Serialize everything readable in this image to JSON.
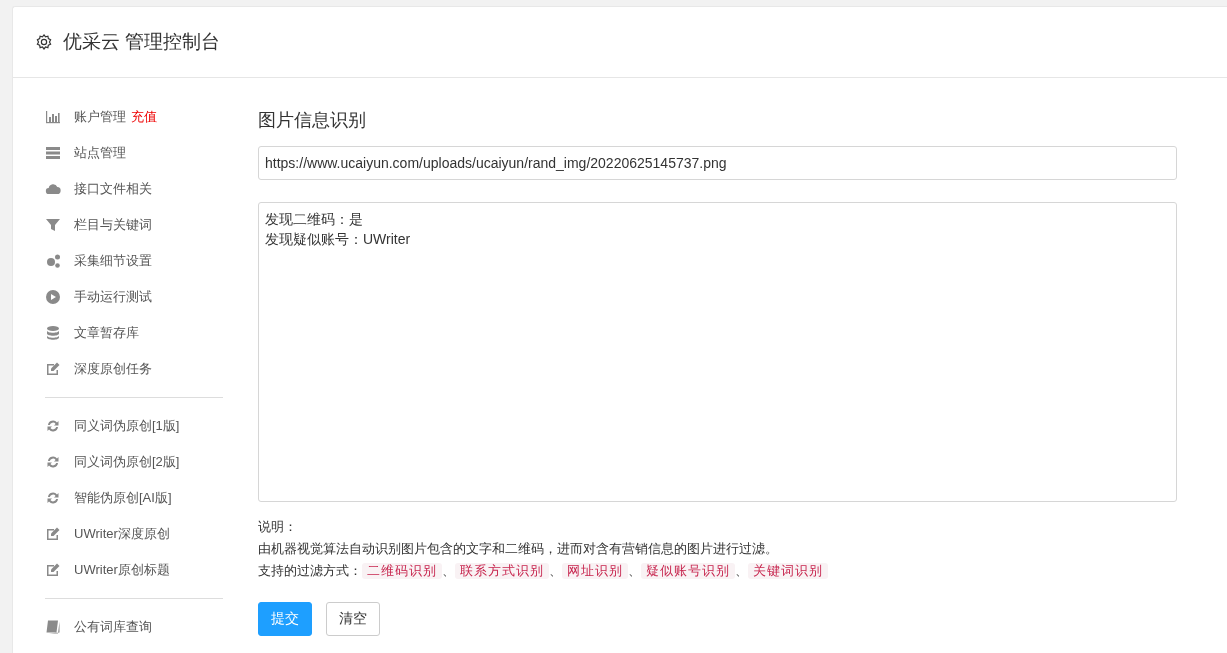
{
  "header": {
    "title": "优采云 管理控制台"
  },
  "sidebar": {
    "sections": [
      {
        "items": [
          {
            "label": "账户管理",
            "badge": "充值"
          },
          {
            "label": "站点管理"
          },
          {
            "label": "接口文件相关"
          },
          {
            "label": "栏目与关键词"
          },
          {
            "label": "采集细节设置"
          },
          {
            "label": "手动运行测试"
          },
          {
            "label": "文章暂存库"
          },
          {
            "label": "深度原创任务"
          }
        ]
      },
      {
        "items": [
          {
            "label": "同义词伪原创[1版]"
          },
          {
            "label": "同义词伪原创[2版]"
          },
          {
            "label": "智能伪原创[AI版]"
          },
          {
            "label": "UWriter深度原创"
          },
          {
            "label": "UWriter原创标题"
          }
        ]
      },
      {
        "items": [
          {
            "label": "公有词库查询"
          }
        ]
      }
    ]
  },
  "main": {
    "title": "图片信息识别",
    "url_field": {
      "value": "https://www.ucaiyun.com/uploads/ucaiyun/rand_img/20220625145737.png"
    },
    "result_field": {
      "lines": [
        "发现二维码：是",
        "发现疑似账号：UWriter"
      ]
    },
    "notes": {
      "heading": "说明：",
      "description": "由机器视觉算法自动识别图片包含的文字和二维码，进而对含有营销信息的图片进行过滤。",
      "filters_label": "支持的过滤方式：",
      "separator": "、",
      "filters": [
        "二维码识别",
        "联系方式识别",
        "网址识别",
        "疑似账号识别",
        "关键词识别"
      ]
    },
    "buttons": [
      {
        "label": "提交",
        "kind": "primary"
      },
      {
        "label": "清空",
        "kind": "default"
      }
    ]
  }
}
